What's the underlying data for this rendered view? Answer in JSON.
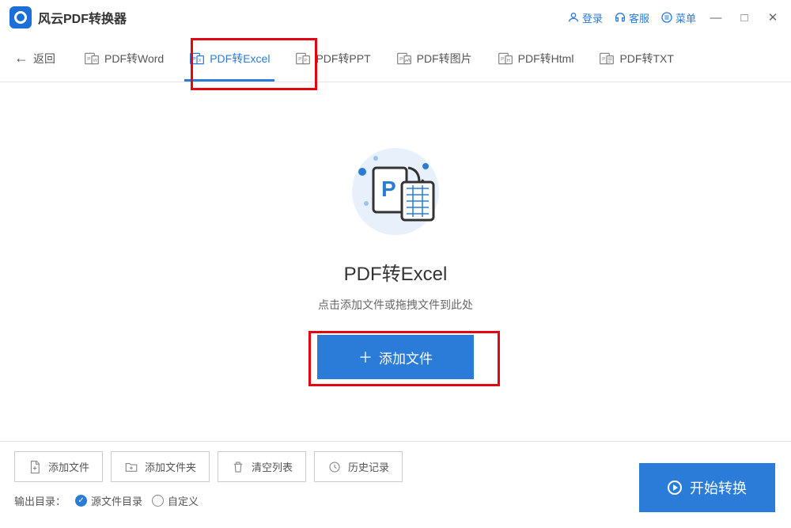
{
  "title_bar": {
    "app_name": "风云PDF转换器",
    "login": "登录",
    "support": "客服",
    "menu": "菜单"
  },
  "tabs": {
    "back": "返回",
    "items": [
      {
        "label": "PDF转Word",
        "icon_letter": "W"
      },
      {
        "label": "PDF转Excel",
        "icon_letter": "X"
      },
      {
        "label": "PDF转PPT",
        "icon_letter": "P"
      },
      {
        "label": "PDF转图片",
        "icon_letter": "图"
      },
      {
        "label": "PDF转Html",
        "icon_letter": "H"
      },
      {
        "label": "PDF转TXT",
        "icon_letter": "T"
      }
    ],
    "active_index": 1
  },
  "main": {
    "heading": "PDF转Excel",
    "subtext": "点击添加文件或拖拽文件到此处",
    "add_button": "添加文件"
  },
  "bottom": {
    "add_file": "添加文件",
    "add_folder": "添加文件夹",
    "clear_list": "清空列表",
    "history": "历史记录",
    "output_label": "输出目录：",
    "radio_source": "源文件目录",
    "radio_custom": "自定义",
    "convert": "开始转换"
  }
}
